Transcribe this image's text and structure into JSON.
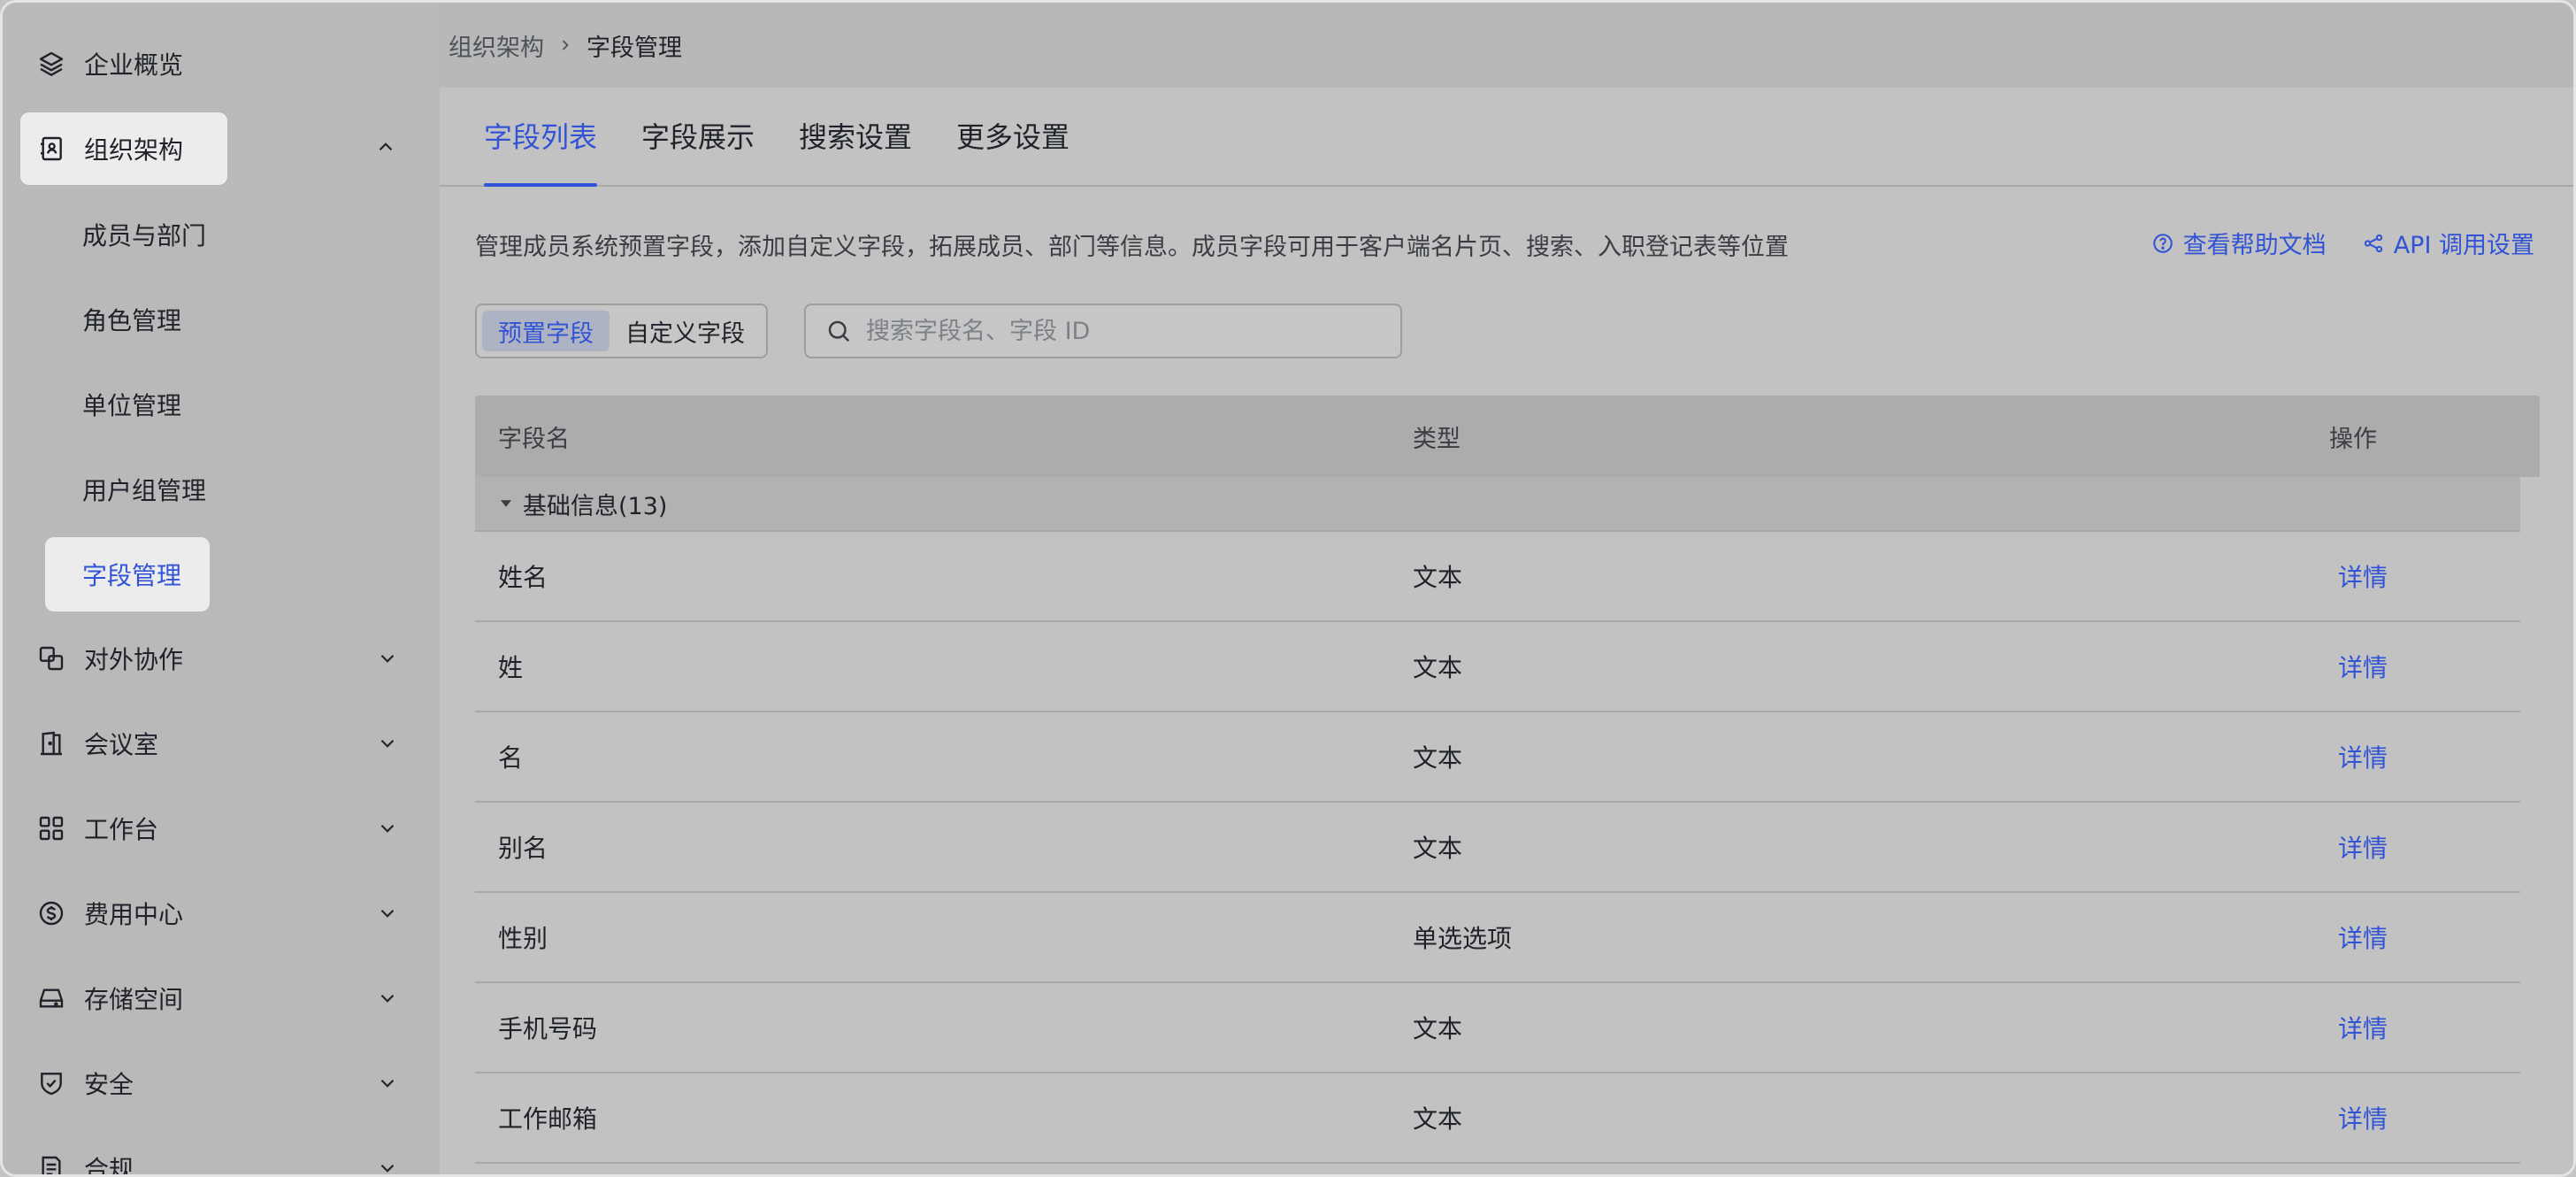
{
  "breadcrumb": {
    "parent": "组织架构",
    "current": "字段管理"
  },
  "sidebar": {
    "items": [
      {
        "label": "企业概览",
        "icon": "layers-icon"
      },
      {
        "label": "组织架构",
        "icon": "contacts-icon",
        "expanded": true,
        "children": [
          "成员与部门",
          "角色管理",
          "单位管理",
          "用户组管理",
          "字段管理"
        ]
      },
      {
        "label": "对外协作",
        "icon": "link-square-icon"
      },
      {
        "label": "会议室",
        "icon": "door-icon"
      },
      {
        "label": "工作台",
        "icon": "grid-icon"
      },
      {
        "label": "费用中心",
        "icon": "dollar-icon"
      },
      {
        "label": "存储空间",
        "icon": "drive-icon"
      },
      {
        "label": "安全",
        "icon": "shield-icon"
      },
      {
        "label": "合规",
        "icon": "document-icon"
      }
    ],
    "active_child": "字段管理"
  },
  "tabs": [
    "字段列表",
    "字段展示",
    "搜索设置",
    "更多设置"
  ],
  "active_tab": "字段列表",
  "description": "管理成员系统预置字段，添加自定义字段，拓展成员、部门等信息。成员字段可用于客户端名片页、搜索、入职登记表等位置",
  "help_links": {
    "docs": "查看帮助文档",
    "api": "API 调用设置"
  },
  "segments": {
    "preset": "预置字段",
    "custom": "自定义字段",
    "active": "预置字段"
  },
  "search": {
    "placeholder": "搜索字段名、字段 ID",
    "value": ""
  },
  "table": {
    "headers": {
      "name": "字段名",
      "type": "类型",
      "op": "操作"
    },
    "group": "基础信息(13)",
    "rows": [
      {
        "name": "姓名",
        "type": "文本",
        "op": "详情"
      },
      {
        "name": "姓",
        "type": "文本",
        "op": "详情"
      },
      {
        "name": "名",
        "type": "文本",
        "op": "详情"
      },
      {
        "name": "别名",
        "type": "文本",
        "op": "详情"
      },
      {
        "name": "性别",
        "type": "单选选项",
        "op": "详情"
      },
      {
        "name": "手机号码",
        "type": "文本",
        "op": "详情"
      },
      {
        "name": "工作邮箱",
        "type": "文本",
        "op": "详情"
      }
    ]
  },
  "colors": {
    "accent": "#3153d6",
    "active_bg": "#ececec"
  }
}
